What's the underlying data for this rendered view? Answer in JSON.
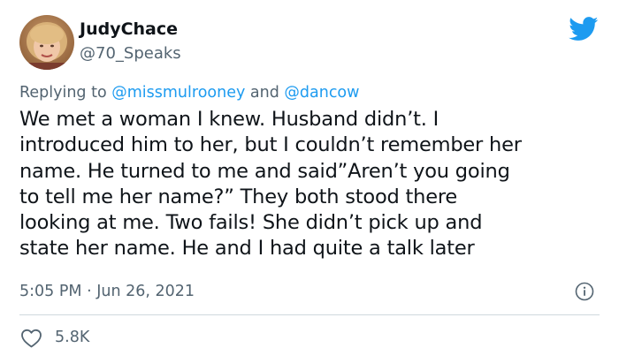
{
  "author": {
    "display_name": "JudyChace",
    "handle": "@70_Speaks"
  },
  "reply": {
    "prefix": "Replying to ",
    "mention1": "@missmulrooney",
    "connector": " and ",
    "mention2": "@dancow"
  },
  "tweet": {
    "lines": [
      "We met a woman I knew. Husband didn’t. I",
      "introduced him to her, but I couldn’t remember her",
      "name. He turned to me and said”Aren’t you going",
      "to tell me her name?” They both stood there",
      "looking at me. Two fails! She didn’t pick up and",
      "state her name. He and I had quite a talk later"
    ],
    "timestamp": "5:05 PM · Jun 26, 2021"
  },
  "engagement": {
    "likes": "5.8K"
  },
  "icons": {
    "brand": "twitter-bird-icon",
    "info": "info-icon",
    "like": "heart-icon"
  },
  "colors": {
    "accent": "#1d9bf0",
    "secondary_text": "#536471",
    "primary_text": "#0f1419",
    "divider": "#cfd9de"
  }
}
